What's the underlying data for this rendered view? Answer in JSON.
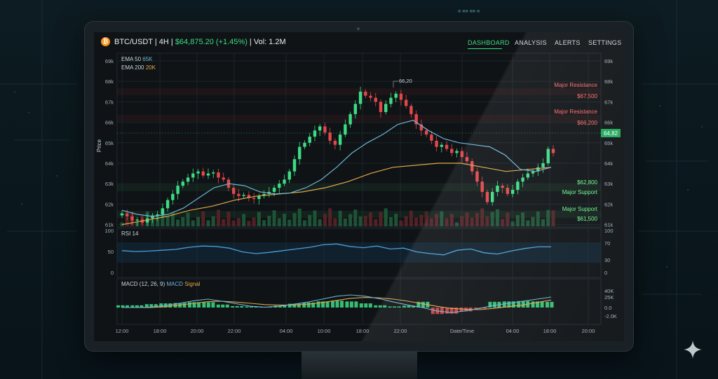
{
  "header": {
    "coin_symbol": "₿",
    "pair": "BTC/USDT | 4H | ",
    "price_change": "$64,875.20 (+1.45%)",
    "volume": " | Vol: 1.2M"
  },
  "nav": {
    "items": [
      {
        "label": "DASHBOARD",
        "active": true
      },
      {
        "label": "ANALYSIS",
        "active": false
      },
      {
        "label": "ALERTS",
        "active": false
      },
      {
        "label": "SETTINGS",
        "active": false
      }
    ]
  },
  "price_axis": {
    "title": "Price",
    "ticks": [
      "69k",
      "68k",
      "67k",
      "66k",
      "65k",
      "64k",
      "63k",
      "62k",
      "61k"
    ]
  },
  "legend": {
    "ema50_label": "EMA 50",
    "ema50_value": "65K",
    "ema200_label": "EMA 200",
    "ema200_value": "20K"
  },
  "levels": {
    "resistance1_label": "Major Resistance",
    "resistance1_value": "$67,500",
    "resistance2_label": "Major Resistance",
    "resistance2_value": "$66,200",
    "support1_label": "Major Support",
    "support1_value": "$61,500",
    "support2_value": "$62,800",
    "support2_label": "Major Support"
  },
  "annotations": {
    "peak_label": "66,20",
    "current_price_tag": "64,82"
  },
  "rsi": {
    "label": "RSI 14",
    "left_ticks": [
      "100",
      "50",
      "0"
    ],
    "right_ticks": [
      "100",
      "70",
      "30",
      "0"
    ]
  },
  "macd": {
    "label": "MACD (12, 26, 9)",
    "macd_label": "MACD",
    "signal_label": "Signal",
    "right_ticks": [
      "40K",
      "25K",
      "0.0",
      "-2.0K"
    ]
  },
  "time_axis": {
    "ticks": [
      "12:00",
      "18:00",
      "20:00",
      "22:00",
      "04:00",
      "10:00",
      "18:00",
      "22:00",
      "Date/Time",
      "04:00",
      "18:00",
      "20:00"
    ]
  },
  "colors": {
    "up": "#3ddc84",
    "down": "#e2474b",
    "ema50": "#6fb4d8",
    "ema200": "#e0a74a",
    "resistance": "#ff4a4a",
    "support": "#4dff7a",
    "accent": "#3ddc84"
  },
  "chart_data": {
    "type": "line",
    "candles_close": [
      61.55,
      61.4,
      61.2,
      61.25,
      61.1,
      61.3,
      61.45,
      61.5,
      61.8,
      62.2,
      62.5,
      62.9,
      63.1,
      63.3,
      63.5,
      63.6,
      63.4,
      63.5,
      63.55,
      63.3,
      63.2,
      62.8,
      62.5,
      62.4,
      62.45,
      62.3,
      62.25,
      62.4,
      62.5,
      62.6,
      62.8,
      63.0,
      63.2,
      63.6,
      64.2,
      64.8,
      65.0,
      65.3,
      65.6,
      65.8,
      65.5,
      65.1,
      64.9,
      65.4,
      65.9,
      66.4,
      66.9,
      67.5,
      67.3,
      67.2,
      67.0,
      66.5,
      66.9,
      67.2,
      67.4,
      67.1,
      66.8,
      66.4,
      65.9,
      65.6,
      65.4,
      65.1,
      64.8,
      64.9,
      64.7,
      64.5,
      64.6,
      64.3,
      64.1,
      63.6,
      63.1,
      62.6,
      62.1,
      62.6,
      62.9,
      62.8,
      62.5,
      62.7,
      63.1,
      63.3,
      63.5,
      63.6,
      63.8,
      64.0,
      64.7,
      64.5
    ],
    "ema50": [
      61.7,
      61.5,
      61.4,
      61.5,
      61.8,
      62.3,
      62.8,
      63.0,
      62.9,
      62.6,
      62.5,
      62.55,
      62.8,
      63.2,
      63.8,
      64.5,
      65.0,
      65.4,
      65.9,
      66.1,
      65.6,
      65.2,
      65.0,
      64.9,
      64.8,
      64.4,
      63.7,
      63.6,
      63.8
    ],
    "ema200": [
      61.0,
      61.2,
      61.4,
      61.7,
      61.9,
      62.2,
      62.4,
      62.5,
      62.6,
      62.8,
      63.1,
      63.5,
      63.8,
      63.9,
      64.0,
      64.0,
      63.8,
      63.6,
      63.7,
      63.8
    ],
    "rsi": [
      52,
      50,
      51,
      53,
      55,
      60,
      63,
      62,
      58,
      49,
      45,
      48,
      52,
      56,
      60,
      66,
      68,
      62,
      59,
      63,
      56,
      58,
      49,
      45,
      42,
      53,
      56,
      47,
      44,
      51,
      57,
      61,
      61
    ],
    "macd": [
      0,
      0,
      1,
      5,
      10,
      16,
      20,
      15,
      9,
      3,
      1,
      3,
      8,
      13,
      20,
      27,
      30,
      27,
      21,
      13,
      6,
      0,
      -8,
      -12,
      -8,
      -2,
      5,
      10,
      15,
      20,
      25
    ],
    "signal": [
      0,
      0,
      0,
      2,
      6,
      10,
      14,
      15,
      13,
      10,
      7,
      6,
      6,
      8,
      12,
      17,
      22,
      24,
      23,
      20,
      15,
      9,
      3,
      -2,
      -4,
      -5,
      -2,
      2,
      6,
      12,
      18
    ],
    "ylim": [
      61,
      69
    ],
    "resistance_levels": [
      67.5,
      66.2
    ],
    "support_levels": [
      62.8,
      61.5
    ]
  }
}
